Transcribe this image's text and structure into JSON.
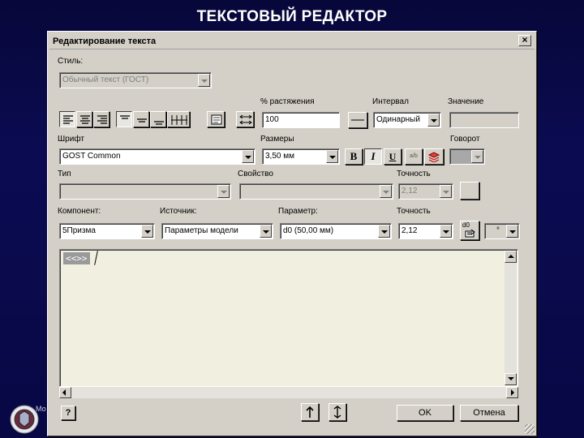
{
  "slide_title": "ТЕКСТОВЫЙ РЕДАКТОР",
  "dialog": {
    "title": "Редактирование текста",
    "close_glyph": "×",
    "style": {
      "label": "Стиль:",
      "value": "Обычный текст (ГОСТ)"
    },
    "stretch": {
      "label": "% растяжения",
      "value": "100"
    },
    "interval": {
      "label": "Интервал",
      "value": "Одинарный"
    },
    "value_field": {
      "label": "Значение",
      "value": ""
    },
    "font": {
      "label": "Шрифт",
      "value": "GOST Common"
    },
    "sizes": {
      "label": "Размеры",
      "value": "3,50 мм"
    },
    "rotation": {
      "label": "Говорот"
    },
    "type": {
      "label": "Тип",
      "value": ""
    },
    "property": {
      "label": "Свойство",
      "value": ""
    },
    "precision1": {
      "label": "Точность",
      "value": "2,12"
    },
    "component": {
      "label": "Компонент:",
      "value": "5Призма"
    },
    "source": {
      "label": "Источник:",
      "value": "Параметры модели"
    },
    "parameter": {
      "label": "Параметр:",
      "value": "d0 (50,00 мм)"
    },
    "precision2": {
      "label": "Точность",
      "value": "2,12"
    },
    "param_button_label": "d0",
    "editor_token": "<<>>",
    "bold_label": "B",
    "italic_label": "I",
    "underline_label": "U",
    "fraction_label": "a/b",
    "symbol_value": "°",
    "help_label": "?",
    "ok_label": "OK",
    "cancel_label": "Отмена"
  },
  "logo_text": "Мо"
}
